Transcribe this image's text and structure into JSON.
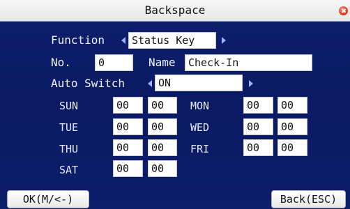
{
  "window": {
    "title": "Backspace"
  },
  "form": {
    "function_label": "Function",
    "function_value": "Status Key",
    "no_label": "No.",
    "no_value": "0",
    "name_label": "Name",
    "name_value": "Check-In",
    "auto_switch_label": "Auto Switch",
    "auto_switch_value": "ON"
  },
  "schedule": [
    {
      "day": "SUN",
      "hour": "00",
      "minute": "00"
    },
    {
      "day": "MON",
      "hour": "00",
      "minute": "00"
    },
    {
      "day": "TUE",
      "hour": "00",
      "minute": "00"
    },
    {
      "day": "WED",
      "hour": "00",
      "minute": "00"
    },
    {
      "day": "THU",
      "hour": "00",
      "minute": "00"
    },
    {
      "day": "FRI",
      "hour": "00",
      "minute": "00"
    },
    {
      "day": "SAT",
      "hour": "00",
      "minute": "00"
    }
  ],
  "buttons": {
    "ok": "OK(M/<-)",
    "back": "Back(ESC)"
  },
  "colors": {
    "background": "#0c1c66",
    "titlebar": "#f0f0f0",
    "close": "#e2402c"
  }
}
